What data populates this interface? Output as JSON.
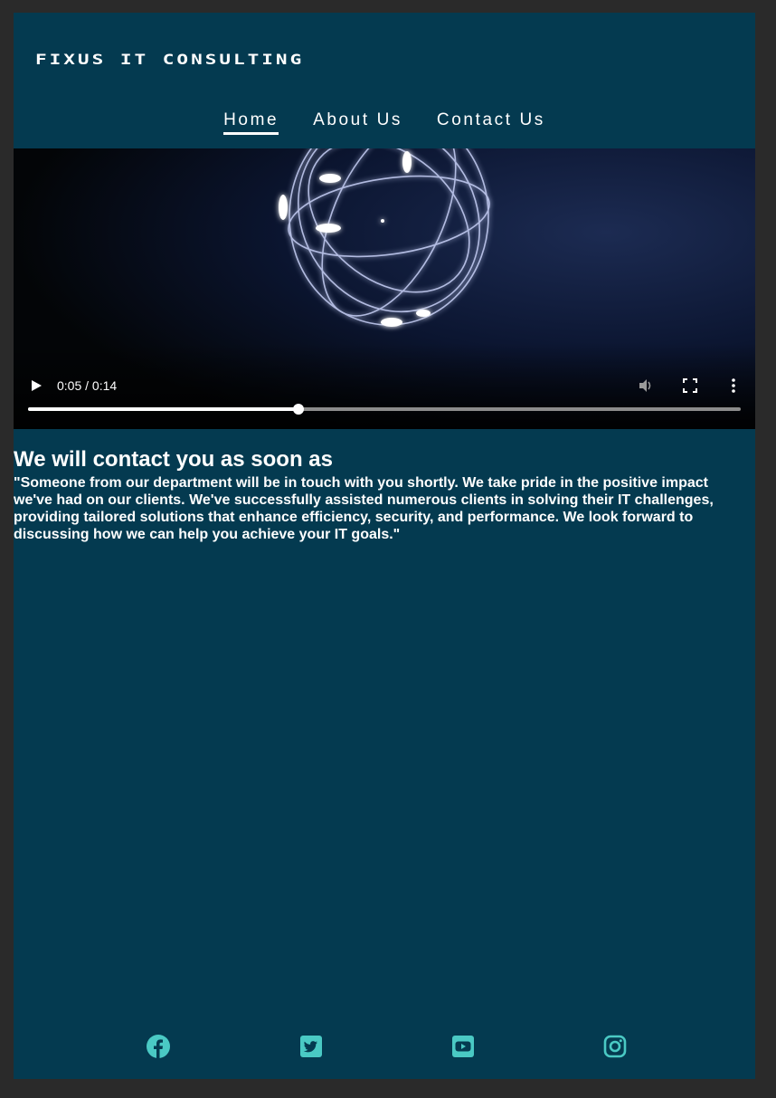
{
  "header": {
    "brand": "FIXUS IT CONSULTING"
  },
  "nav": {
    "items": [
      {
        "label": "Home",
        "active": true
      },
      {
        "label": "About Us",
        "active": false
      },
      {
        "label": "Contact Us",
        "active": false
      }
    ]
  },
  "video": {
    "time_display": "0:05 / 0:14",
    "progress_fraction": 0.38,
    "icons": [
      "play-icon",
      "volume-icon",
      "fullscreen-icon",
      "more-options-icon"
    ]
  },
  "content": {
    "heading": "We will contact you as soon as",
    "paragraph": "\"Someone from our department will be in touch with you shortly. We take pride in the positive impact we've had on our clients. We've successfully assisted numerous clients in solving their IT challenges, providing tailored solutions that enhance efficiency, security, and performance. We look forward to discussing how we can help you achieve your IT goals.\""
  },
  "footer": {
    "social_icons": [
      "facebook-icon",
      "twitter-icon",
      "youtube-icon",
      "instagram-icon"
    ],
    "icon_color": "#4ac9c4"
  },
  "colors": {
    "page_background": "#043a50",
    "outer_background": "#2a2a2a",
    "text": "#ffffff"
  }
}
